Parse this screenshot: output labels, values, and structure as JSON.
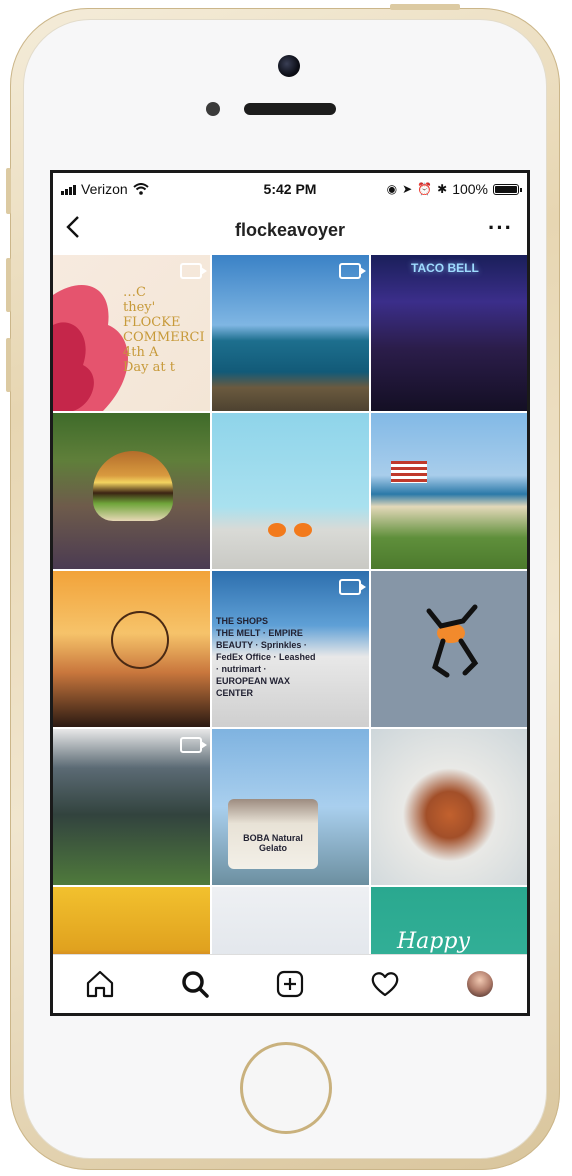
{
  "status": {
    "carrier": "Verizon",
    "time": "5:42 PM",
    "battery": "100%"
  },
  "header": {
    "title": "flockeavoyer",
    "back_icon": "chevron-left-icon",
    "more_label": "···"
  },
  "tiles": [
    {
      "text": "…C\nthey'\nFLOCKE\nCOMMERCI\n4th A\nDay at t",
      "video": true
    },
    {
      "text": "",
      "video": true
    },
    {
      "text": "TACO BELL",
      "video": false
    },
    {
      "text": "",
      "video": false
    },
    {
      "text": "",
      "video": false
    },
    {
      "text": "",
      "video": false
    },
    {
      "text": "",
      "video": false
    },
    {
      "text": "THE SHOPS\nTHE MELT · EMPIRE BEAUTY · Sprinkles · FedEx Office · Leashed · nutrimart · EUROPEAN WAX CENTER",
      "video": true
    },
    {
      "text": "",
      "video": false
    },
    {
      "text": "",
      "video": true
    },
    {
      "text": "BOBA Natural Gelato",
      "video": false
    },
    {
      "text": "",
      "video": false
    },
    {
      "text": "",
      "video": false
    },
    {
      "text": "",
      "video": false
    },
    {
      "text": "Happy",
      "video": false
    }
  ],
  "tabbar": [
    "home-icon",
    "search-icon",
    "add-post-icon",
    "heart-icon",
    "profile-avatar"
  ]
}
